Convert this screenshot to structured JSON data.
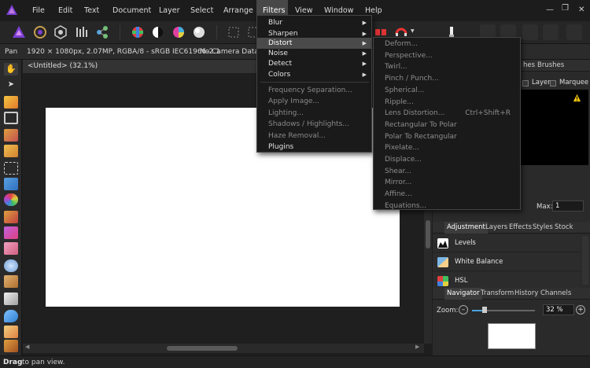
{
  "menubar": {
    "items": [
      "File",
      "Edit",
      "Text",
      "Document",
      "Layer",
      "Select",
      "Arrange",
      "Filters",
      "View",
      "Window",
      "Help"
    ],
    "active": "Filters"
  },
  "context": {
    "tool": "Pan",
    "doc_info": "1920 × 1080px, 2.07MP, RGBA/8 - sRGB IEC61966-2.1",
    "camera": "No Camera Data"
  },
  "document": {
    "tab_title": "<Untitled> (32.1%)"
  },
  "status": {
    "bold": "Drag",
    "text": "to pan view."
  },
  "filters_menu": {
    "items": [
      {
        "label": "Blur",
        "submenu": true,
        "enabled": true
      },
      {
        "label": "Sharpen",
        "submenu": true,
        "enabled": true
      },
      {
        "label": "Distort",
        "submenu": true,
        "enabled": true,
        "highlighted": true
      },
      {
        "label": "Noise",
        "submenu": true,
        "enabled": true
      },
      {
        "label": "Detect",
        "submenu": true,
        "enabled": true
      },
      {
        "label": "Colors",
        "submenu": true,
        "enabled": true
      },
      {
        "label": "Frequency Separation...",
        "enabled": false
      },
      {
        "label": "Apply Image...",
        "enabled": false
      },
      {
        "label": "Lighting...",
        "enabled": false
      },
      {
        "label": "Shadows / Highlights...",
        "enabled": false
      },
      {
        "label": "Haze Removal...",
        "enabled": false
      },
      {
        "label": "Plugins",
        "enabled": true
      }
    ]
  },
  "distort_menu": {
    "items": [
      {
        "label": "Deform...",
        "shortcut": ""
      },
      {
        "label": "Perspective...",
        "shortcut": ""
      },
      {
        "label": "Twirl...",
        "shortcut": ""
      },
      {
        "label": "Pinch / Punch...",
        "shortcut": ""
      },
      {
        "label": "Spherical...",
        "shortcut": ""
      },
      {
        "label": "Ripple...",
        "shortcut": ""
      },
      {
        "label": "Lens Distortion...",
        "shortcut": "Ctrl+Shift+R"
      },
      {
        "label": "Rectangular To Polar",
        "shortcut": ""
      },
      {
        "label": "Polar To Rectangular",
        "shortcut": ""
      },
      {
        "label": "Pixelate...",
        "shortcut": ""
      },
      {
        "label": "Displace...",
        "shortcut": ""
      },
      {
        "label": "Shear...",
        "shortcut": ""
      },
      {
        "label": "Mirror...",
        "shortcut": ""
      },
      {
        "label": "Affine...",
        "shortcut": ""
      },
      {
        "label": "Equations...",
        "shortcut": ""
      }
    ]
  },
  "top_panel": {
    "tabs": [
      "hes",
      "Brushes"
    ],
    "layer_label": "Layer",
    "marquee_label": "Marquee",
    "max_label": "Max:",
    "max_value": "1"
  },
  "adjustment_panel": {
    "tabs": [
      "Adjustment",
      "Layers",
      "Effects",
      "Styles",
      "Stock"
    ],
    "items": [
      "Levels",
      "White Balance",
      "HSL"
    ]
  },
  "navigator_panel": {
    "tabs": [
      "Navigator",
      "Transform",
      "History",
      "Channels"
    ],
    "zoom_label": "Zoom:",
    "zoom_value": "32 %",
    "zoom_level": 0.2
  },
  "colors": {
    "accent_purple": "#7b3fd1",
    "menu_highlight": "#4a4a4a",
    "warning": "#f1c40f"
  }
}
